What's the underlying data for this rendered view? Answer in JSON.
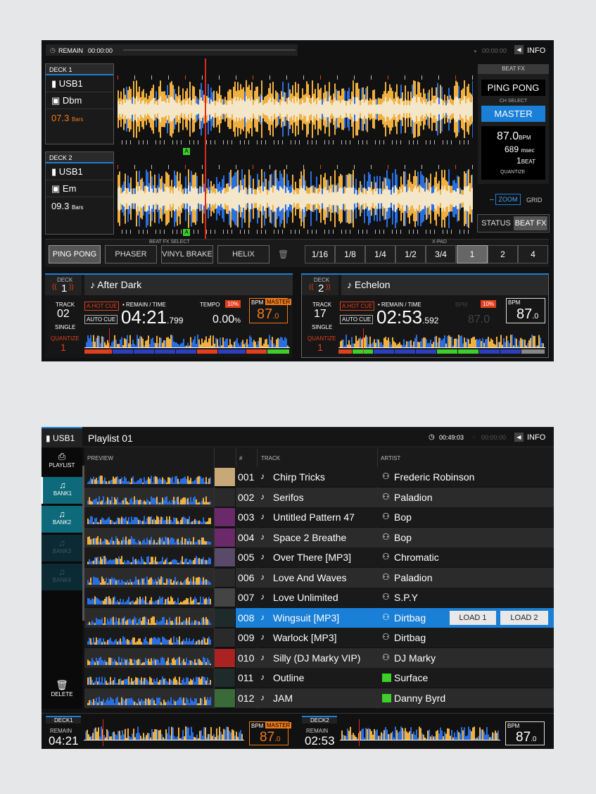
{
  "top": {
    "remain_label": "REMAIN",
    "remain_time": "00:00:00",
    "right_time": "00:00:00",
    "info_label": "INFO",
    "deck1": {
      "label": "DECK 1",
      "source": "USB1",
      "key": "Dbm",
      "bars_value": "07.3",
      "bars_unit": "Bars"
    },
    "deck2": {
      "label": "DECK 2",
      "source": "USB1",
      "key": "Em",
      "bars_value": "09.3",
      "bars_unit": "Bars"
    },
    "beatfx": {
      "header": "BEAT FX",
      "effect": "PING PONG",
      "ch_select_label": "CH SELECT",
      "ch_value": "MASTER",
      "bpm_value": "87.0",
      "bpm_unit": "BPM",
      "msec_value": "689",
      "msec_unit": "msec",
      "beat_value": "1",
      "beat_unit": "BEAT",
      "quantize": "QUANTIZE"
    },
    "zoom_minus": "–",
    "zoom_label": "ZOOM",
    "grid_label": "GRID",
    "status_label": "STATUS",
    "beatfx_tab": "BEAT FX",
    "cue_marker": "A",
    "fx_select_label": "BEAT FX SELECT",
    "xpad_label": "X-PAD",
    "fx_buttons": [
      "PING PONG",
      "PHASER",
      "VINYL BRAKE",
      "HELIX"
    ],
    "xpad_buttons": [
      "1/16",
      "1/8",
      "1/4",
      "1/2",
      "3/4",
      "1",
      "2",
      "4"
    ],
    "deck1_info": {
      "deck_label": "DECK",
      "deck_num": "1",
      "title": "After Dark",
      "track_label": "TRACK",
      "track_num": "02",
      "mode": "SINGLE",
      "hot_cue": "A.HOT CUE",
      "auto_cue": "AUTO CUE",
      "remain_label": "• REMAIN / TIME",
      "time_main": "04:21",
      "time_ms": ".799",
      "tempo_label": "TEMPO",
      "tempo_range": "10%",
      "tempo_value": "0.00",
      "tempo_unit": "%",
      "bpm_label": "BPM",
      "master_label": "MASTER",
      "bpm_int": "87",
      "bpm_dec": ".0",
      "quantize_label": "QUANTIZE",
      "quantize_value": "1"
    },
    "deck2_info": {
      "deck_label": "DECK",
      "deck_num": "2",
      "title": "Echelon",
      "track_label": "TRACK",
      "track_num": "17",
      "mode": "SINGLE",
      "hot_cue": "A.HOT CUE",
      "auto_cue": "AUTO CUE",
      "remain_label": "• REMAIN / TIME",
      "time_main": "02:53",
      "time_ms": ".592",
      "tempo_ghost_label": "BPM",
      "tempo_range": "10%",
      "tempo_ghost": "87.0",
      "bpm_label": "BPM",
      "bpm_int": "87",
      "bpm_dec": ".0",
      "quantize_label": "QUANTIZE",
      "quantize_value": "1"
    }
  },
  "browser": {
    "source": "USB1",
    "title": "Playlist 01",
    "time": "00:49:03",
    "ghost_time": "00:00:00",
    "info_label": "INFO",
    "sidebar": [
      {
        "label": "PLAYLIST",
        "state": "normal"
      },
      {
        "label": "BANK1",
        "state": "active"
      },
      {
        "label": "BANK2",
        "state": "active"
      },
      {
        "label": "BANK3",
        "state": "dim"
      },
      {
        "label": "BANK4",
        "state": "dim"
      }
    ],
    "delete_label": "DELETE",
    "columns": {
      "preview": "PREVIEW",
      "num": "#",
      "track": "TRACK",
      "artist": "ARTIST"
    },
    "rows": [
      {
        "num": "001",
        "track": "Chirp Tricks",
        "artist": "Frederic Robinson",
        "artist_icon": "person"
      },
      {
        "num": "002",
        "track": "Serifos",
        "artist": "Paladion",
        "artist_icon": "person"
      },
      {
        "num": "003",
        "track": "Untitled Pattern 47",
        "artist": "Bop",
        "artist_icon": "person"
      },
      {
        "num": "004",
        "track": "Space 2 Breathe",
        "artist": "Bop",
        "artist_icon": "person"
      },
      {
        "num": "005",
        "track": "Over There [MP3]",
        "artist": "Chromatic",
        "artist_icon": "person"
      },
      {
        "num": "006",
        "track": "Love And Waves",
        "artist": "Paladion",
        "artist_icon": "person"
      },
      {
        "num": "007",
        "track": "Love Unlimited",
        "artist": "S.P.Y",
        "artist_icon": "person"
      },
      {
        "num": "008",
        "track": "Wingsuit [MP3]",
        "artist": "Dirtbag",
        "artist_icon": "person"
      },
      {
        "num": "009",
        "track": "Warlock [MP3]",
        "artist": "Dirtbag",
        "artist_icon": "person"
      },
      {
        "num": "010",
        "track": "Silly (DJ Marky VIP)",
        "artist": "DJ Marky",
        "artist_icon": "person"
      },
      {
        "num": "011",
        "track": "Outline",
        "artist": "Surface",
        "artist_icon": "green"
      },
      {
        "num": "012",
        "track": "JAM",
        "artist": "Danny Byrd",
        "artist_icon": "green"
      }
    ],
    "load1": "LOAD 1",
    "load2": "LOAD 2",
    "bottom": {
      "deck1": {
        "label": "DECK1",
        "remain": "REMAIN",
        "time": "04:21",
        "bpm_label": "BPM",
        "master": "MASTER",
        "bpm_int": "87",
        "bpm_dec": ".0"
      },
      "deck2": {
        "label": "DECK2",
        "remain": "REMAIN",
        "time": "02:53",
        "bpm_label": "BPM",
        "bpm_int": "87",
        "bpm_dec": ".0"
      }
    }
  },
  "colors": {
    "accent_blue": "#1a7fd6",
    "orange": "#f07a1a",
    "red": "#e0401c",
    "green": "#3ecf2a"
  }
}
